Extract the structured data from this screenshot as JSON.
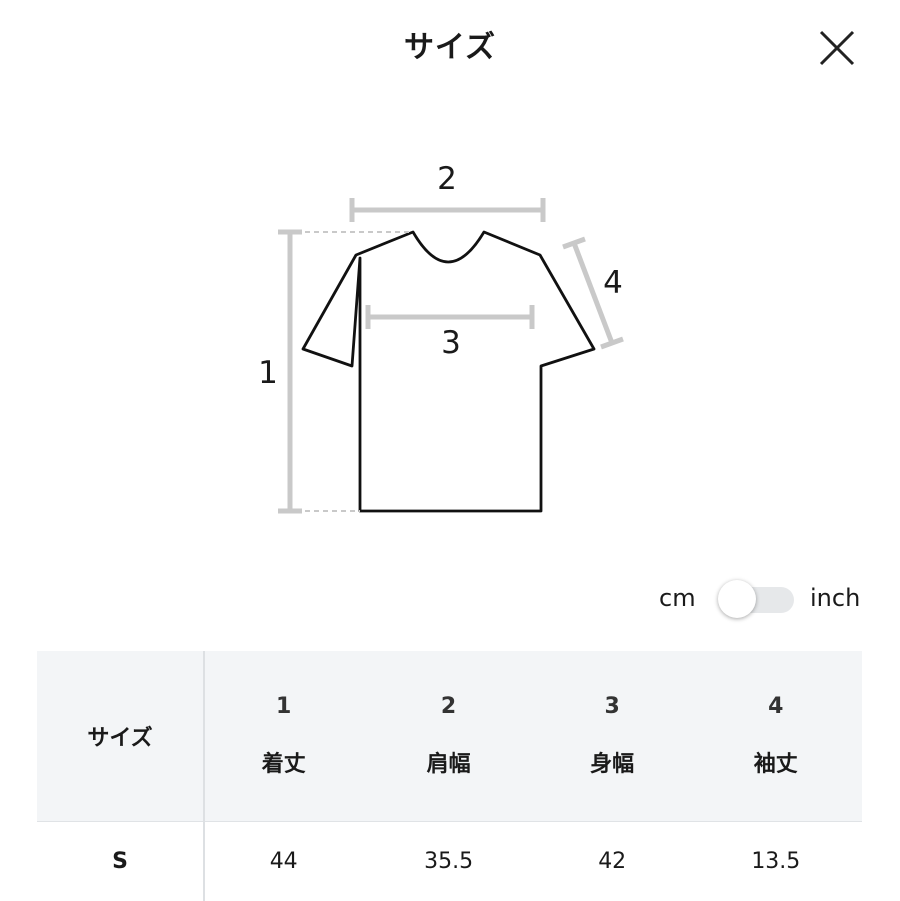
{
  "header": {
    "title": "サイズ"
  },
  "diagram": {
    "labels": [
      "1",
      "2",
      "3",
      "4"
    ]
  },
  "unit_toggle": {
    "left_label": "cm",
    "right_label": "inch",
    "selected": "cm"
  },
  "table": {
    "corner_label": "サイズ",
    "columns": [
      {
        "num": "1",
        "name": "着丈"
      },
      {
        "num": "2",
        "name": "肩幅"
      },
      {
        "num": "3",
        "name": "身幅"
      },
      {
        "num": "4",
        "name": "袖丈"
      }
    ],
    "rows": [
      {
        "size": "S",
        "values": [
          "44",
          "35.5",
          "42",
          "13.5"
        ]
      }
    ]
  }
}
